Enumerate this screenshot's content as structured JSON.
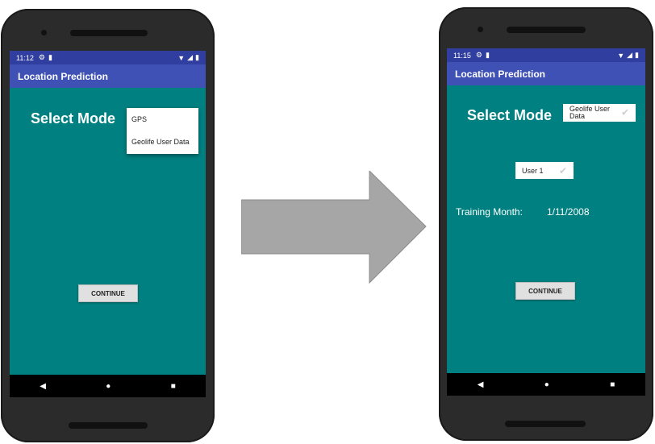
{
  "left_phone": {
    "status": {
      "time": "11:12"
    },
    "app_title": "Location Prediction",
    "heading": "Select Mode",
    "mode_menu": [
      "GPS",
      "Geolife User Data"
    ],
    "continue_label": "CONTINUE"
  },
  "right_phone": {
    "status": {
      "time": "11:15"
    },
    "app_title": "Location Prediction",
    "heading": "Select Mode",
    "mode_selected": "Geolife User Data",
    "user_selected": "User 1",
    "training_label": "Training Month:",
    "training_value": "1/11/2008",
    "continue_label": "CONTINUE"
  },
  "icons": {
    "status": [
      "gear-icon",
      "sd-card-icon",
      "wifi-icon",
      "signal-icon",
      "battery-icon"
    ],
    "nav": [
      "back-icon",
      "home-icon",
      "recents-icon"
    ],
    "spinner": "checkmark-icon",
    "transition": "right-arrow-icon"
  },
  "colors": {
    "screen_bg": "#008080",
    "app_bar": "#3f51b5",
    "status_bar": "#303f9f",
    "button_bg": "#e0e0e0",
    "arrow": "#a6a6a6"
  }
}
